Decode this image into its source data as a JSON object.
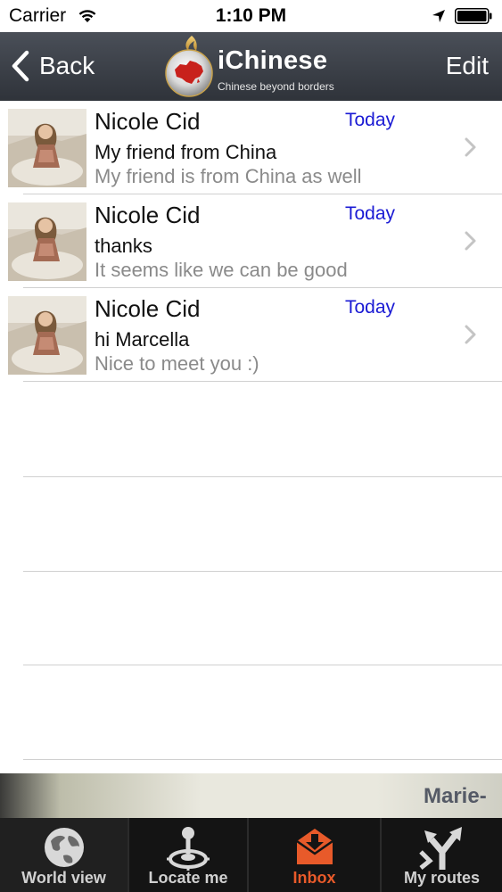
{
  "status_bar": {
    "carrier": "Carrier",
    "time": "1:10 PM"
  },
  "nav": {
    "back_label": "Back",
    "app_title": "iChinese",
    "app_subtitle": "Chinese  beyond borders",
    "edit_label": "Edit"
  },
  "messages": [
    {
      "name": "Nicole Cid",
      "date": "Today",
      "subject": "My friend from China",
      "preview": "My friend is from China as well"
    },
    {
      "name": "Nicole Cid",
      "date": "Today",
      "subject": "thanks",
      "preview": "It seems like we can be good"
    },
    {
      "name": "Nicole Cid",
      "date": "Today",
      "subject": "hi Marcella",
      "preview": "Nice to meet you :)"
    }
  ],
  "banner": {
    "text": "Marie-"
  },
  "tabs": [
    {
      "label": "World view",
      "icon": "globe-icon"
    },
    {
      "label": "Locate me",
      "icon": "joystick-icon"
    },
    {
      "label": "Inbox",
      "icon": "inbox-icon",
      "active": true
    },
    {
      "label": "My routes",
      "icon": "routes-icon"
    }
  ],
  "colors": {
    "nav_bg": "#3a3e46",
    "date_blue": "#1a1ad4",
    "active_tab": "#e85a2a",
    "tab_bar_bg": "#141414"
  }
}
